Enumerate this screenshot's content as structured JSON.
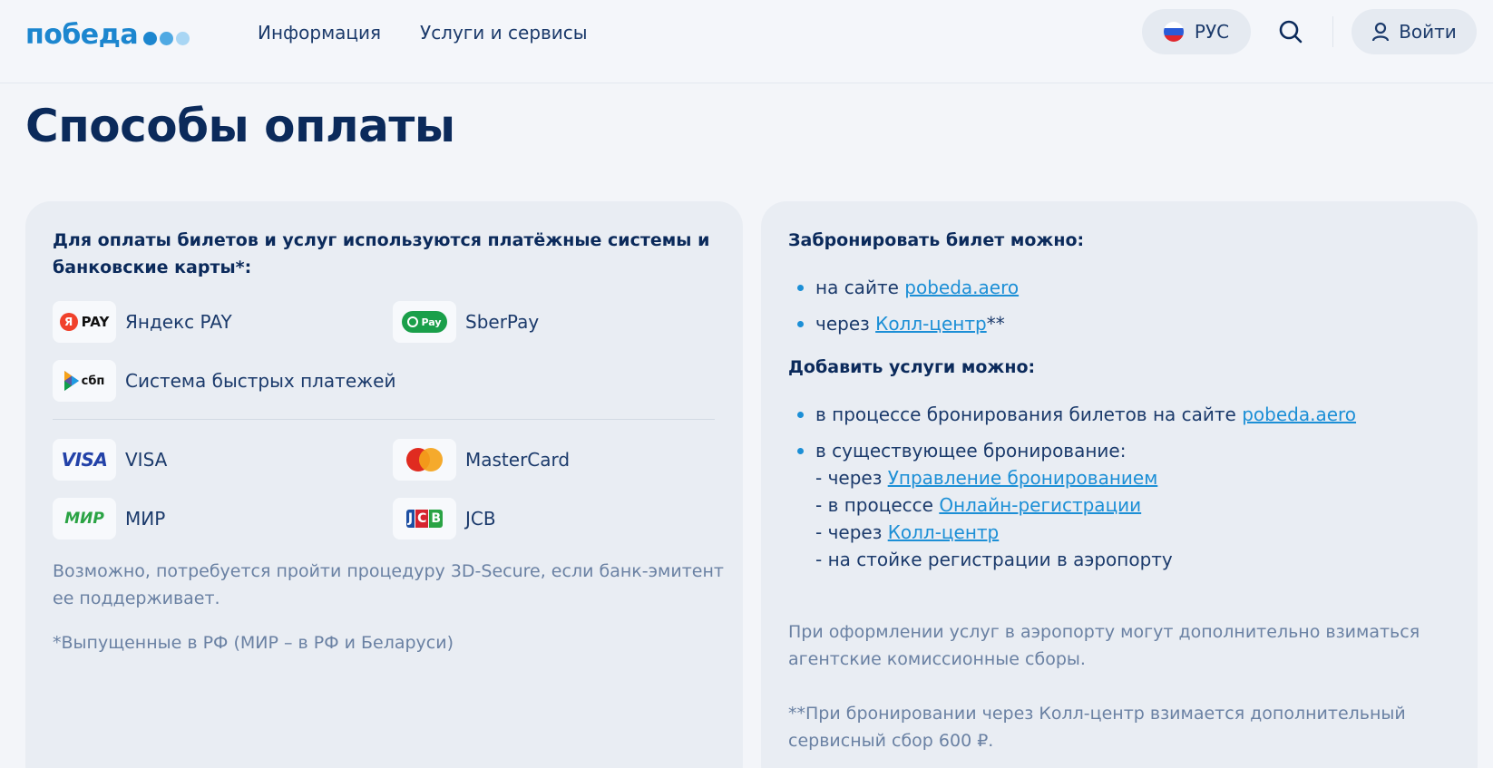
{
  "header": {
    "logo_text": "победа",
    "nav": [
      "Информация",
      "Услуги и сервисы"
    ],
    "lang_label": "РУС",
    "login_label": "Войти"
  },
  "page_title": "Способы оплаты",
  "left_card": {
    "heading_line1": "Для оплаты билетов и услуг используются платёжные системы и",
    "heading_line2": "банковские карты*:",
    "methods": {
      "yandex": {
        "label": "Яндекс PAY",
        "logo_text": "PAY",
        "logo_letter": "Я"
      },
      "sberpay": {
        "label": "SberPay",
        "logo_text": "Pay"
      },
      "sbp": {
        "label": "Система быстрых платежей",
        "logo_text": "сбп"
      },
      "visa": {
        "label": "VISA",
        "logo_text": "VISA"
      },
      "mastercard": {
        "label": "MasterCard"
      },
      "mir": {
        "label": "МИР",
        "logo_text": "МИР"
      },
      "jcb": {
        "label": "JCB",
        "logo_text": "JCB"
      }
    },
    "note_3ds_line1": "Возможно, потребуется пройти процедуру 3D-Secure, если банк-эмитент",
    "note_3ds_line2": "ее поддерживает.",
    "note_issued": "*Выпущенные в РФ (МИР – в РФ и Беларуси)"
  },
  "right_card": {
    "book_heading": "Забронировать билет можно:",
    "book_site_prefix": "на сайте ",
    "book_site_link": "pobeda.aero",
    "book_call_prefix": "через ",
    "book_call_link": "Колл-центр",
    "book_call_suffix": "**",
    "services_heading": "Добавить услуги можно:",
    "svc_booking_prefix": "в процессе бронирования билетов на сайте ",
    "svc_booking_link": "pobeda.aero",
    "svc_existing": "в существующее бронирование:",
    "sub1_prefix": "- через ",
    "sub1_link": "Управление бронированием",
    "sub2_prefix": "- в процессе ",
    "sub2_link": "Онлайн-регистрации",
    "sub3_prefix": "- через ",
    "sub3_link": "Колл-центр",
    "sub4": "- на стойке регистрации в аэропорту",
    "note_airport_line1": "При оформлении услуг в аэропорту могут дополнительно взиматься",
    "note_airport_line2": "агентские комиссионные сборы.",
    "note_call_line1": "**При бронировании через Колл-центр взимается дополнительный",
    "note_call_line2": "сервисный сбор 600 ₽."
  },
  "colors": {
    "brand_blue": "#1c86cf",
    "link_blue": "#1c8fd6",
    "title_navy": "#0b2a5b",
    "muted_text": "#6a81a3"
  }
}
